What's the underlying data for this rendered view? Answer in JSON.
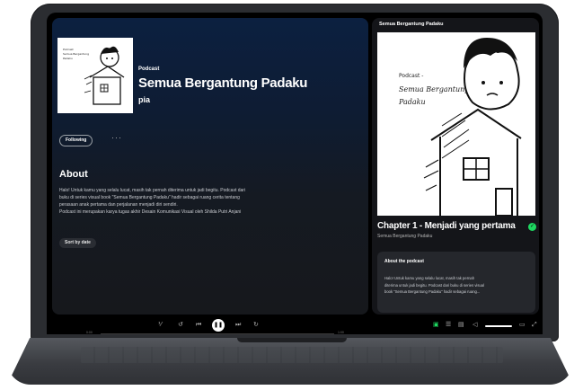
{
  "main": {
    "podcast_type": "Podcast",
    "title": "Semua Bergantung Padaku",
    "author": "pia",
    "following_label": "Following",
    "more_label": "···",
    "about_heading": "About",
    "about_lines": [
      "Halo! Untuk kamu yang selalu lucat, masih tak pernah diterima untuk jadi begitu. Podcast dari",
      "buku di series visual book \"Semua Bergantung Padaku\" hadir sebagai ruang cerita tentang",
      "perasaan anak pertama dan perjalanan menjadi diri sendiri.",
      "Podcast ini merupakan karya tugas akhir Desain Komunikasi Visual oleh Shilda Putri Anjani"
    ],
    "sort_label": "Sort by date"
  },
  "cover": {
    "small_caption_lines": [
      "Podcast",
      "Semua Bergantung",
      "Padaku"
    ],
    "large_caption_lines": [
      "Podcast -",
      "Semua Bergantung",
      "Padaku"
    ]
  },
  "side": {
    "header": "Semua Bergantung Padaku",
    "episode_title": "Chapter 1 - Menjadi yang pertama",
    "episode_show": "Semua Bergantung Padaku",
    "card_heading": "About the podcast",
    "card_lines": [
      "Halo! Untuk kamu yang selalu lucat, masih tak pernah",
      "diterima untuk jadi begitu. Podcast dari buku di series visual",
      "book \"Semua Bergantung Padaku\" hadir sebagai ruang..."
    ]
  },
  "player": {
    "time_elapsed": "0:00",
    "time_total": "1:00",
    "volume_level": 1.0
  },
  "colors": {
    "accent_green": "#1ed760",
    "panel_bg": "#141519",
    "laptop_body": "#2b2d31"
  },
  "icons": {
    "shuffle": "speed-icon",
    "previous": "skip-back-icon",
    "play": "pause-icon",
    "next": "skip-forward-icon",
    "check": "check-circle-icon"
  }
}
